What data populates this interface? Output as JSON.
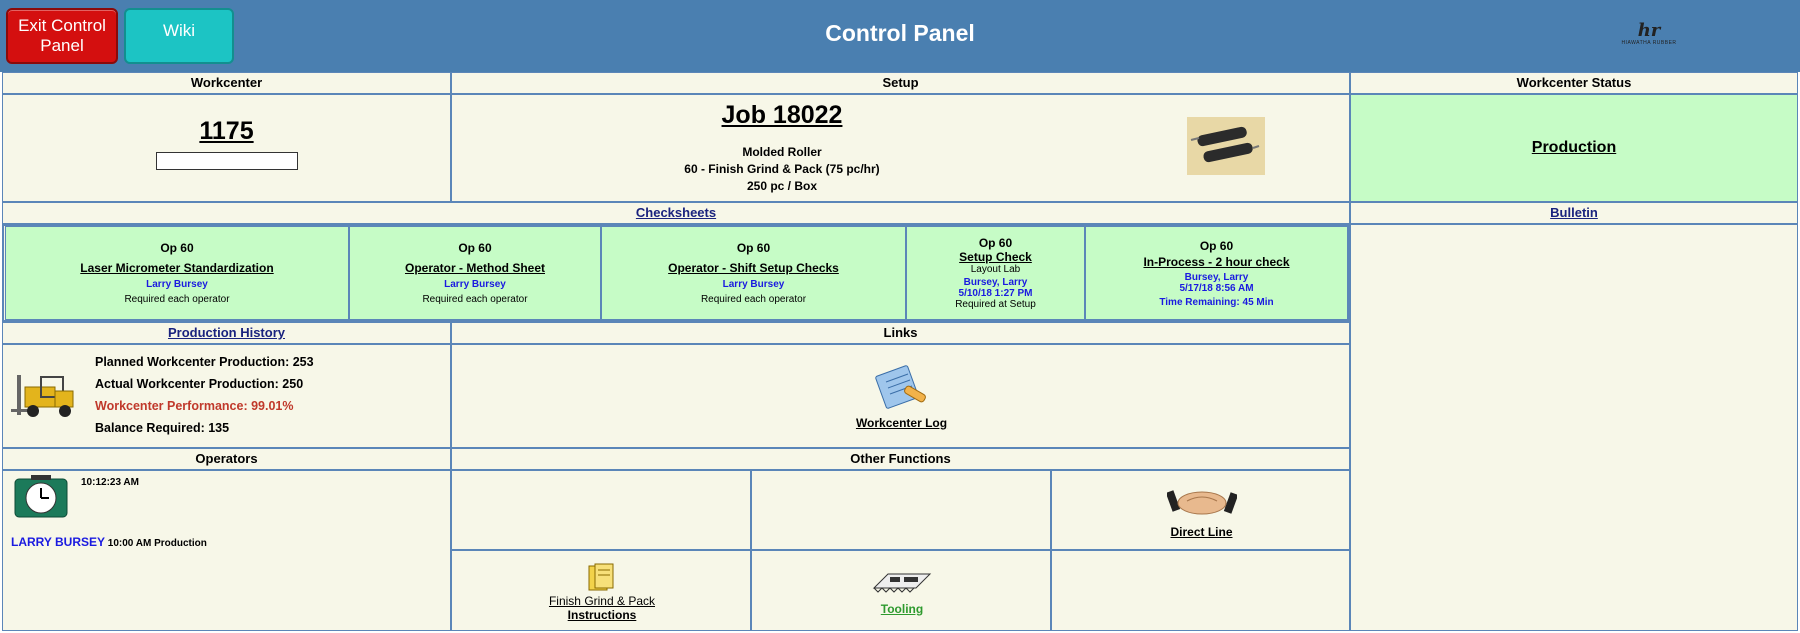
{
  "topbar": {
    "exit_label": "Exit Control Panel",
    "wiki_label": "Wiki",
    "title": "Control Panel",
    "logo_mark": "hr",
    "logo_sub": "HIAWATHA RUBBER"
  },
  "workcenter": {
    "header": "Workcenter",
    "number": "1175",
    "input_value": ""
  },
  "setup": {
    "header": "Setup",
    "job": "Job 18022",
    "part": "Molded Roller",
    "operation": "60 - Finish Grind & Pack  (75 pc/hr)",
    "packaging": "250 pc / Box"
  },
  "status": {
    "header": "Workcenter Status",
    "value": "Production"
  },
  "checksheets": {
    "header": "Checksheets",
    "items": [
      {
        "op": "Op 60",
        "title": "Laser Micrometer Standardization",
        "blue": "Larry Bursey",
        "note": "Required each operator"
      },
      {
        "op": "Op 60",
        "title": "Operator - Method Sheet",
        "blue": "Larry Bursey",
        "note": "Required each operator"
      },
      {
        "op": "Op 60",
        "title": "Operator - Shift Setup Checks",
        "blue": "Larry Bursey",
        "note": "Required each operator"
      },
      {
        "op": "Op 60",
        "title": "Setup Check",
        "sub": "Layout Lab",
        "blue": "Bursey, Larry",
        "blue2": "5/10/18 1:27 PM",
        "note": "Required at Setup"
      },
      {
        "op": "Op 60",
        "title": "In-Process - 2 hour check",
        "blue": "Bursey, Larry",
        "blue2": "5/17/18 8:56 AM",
        "blue3": "Time Remaining: 45 Min"
      }
    ]
  },
  "bulletin": {
    "header": "Bulletin"
  },
  "production_history": {
    "header": "Production History",
    "planned": "Planned Workcenter Production: 253",
    "actual": "Actual Workcenter Production: 250",
    "performance": "Workcenter Performance: 99.01%",
    "balance": "Balance Required:  135"
  },
  "links": {
    "header": "Links",
    "workcenter_log": "Workcenter Log"
  },
  "operators": {
    "header": "Operators",
    "time": "10:12:23 AM",
    "name": "LARRY BURSEY",
    "detail": "10:00 AM Production"
  },
  "other_functions": {
    "header": "Other Functions",
    "direct_line": "Direct Line",
    "instructions_line1": "Finish Grind & Pack",
    "instructions_line2": "Instructions",
    "tooling": "Tooling"
  },
  "colors": {
    "topbar": "#4a7fb0",
    "exit": "#d40f0f",
    "wiki": "#1cc4c4",
    "panel": "#f7f7e8",
    "green": "#c6fcc6"
  }
}
